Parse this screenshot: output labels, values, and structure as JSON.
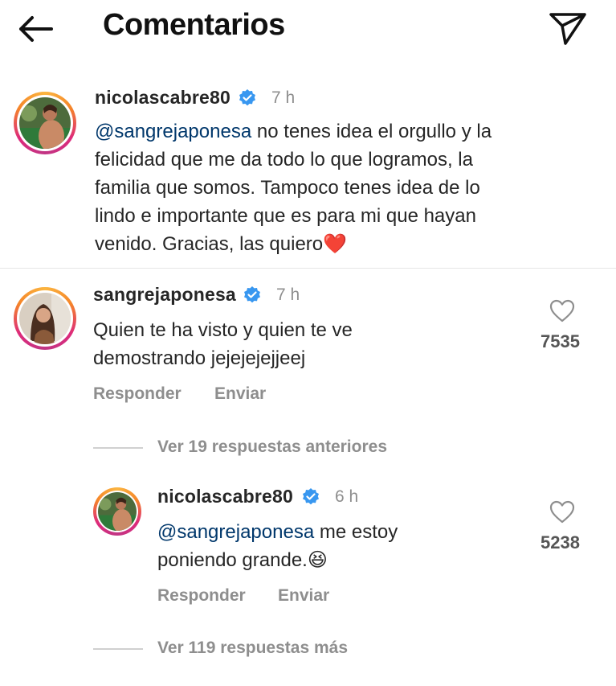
{
  "header": {
    "title": "Comentarios",
    "back_icon": "arrow-left-icon",
    "share_icon": "paper-plane-icon"
  },
  "caption": {
    "username": "nicolascabre80",
    "time": "7 h",
    "mention": "@sangrejaponesa",
    "lines": [
      " no tenes idea el orgullo y la",
      "felicidad que me da todo lo que logramos, la",
      "familia que somos.  Tampoco tenes idea de lo",
      "lindo e importante que es para mi que hayan",
      "venido. Gracias, las quiero"
    ],
    "emoji": "❤️"
  },
  "comment": {
    "username": "sangrejaponesa",
    "time": "7 h",
    "lines": [
      "Quien te ha visto y quien te ve",
      "demostrando jejejejejjeej"
    ],
    "likes": "7535",
    "reply_label": "Responder",
    "send_label": "Enviar"
  },
  "view_previous": "Ver 19 respuestas anteriores",
  "reply": {
    "username": "nicolascabre80",
    "time": "6 h",
    "mention": "@sangrejaponesa",
    "line1": " me estoy",
    "line2": "poniendo grande.",
    "emoji": "😆",
    "likes": "5238",
    "reply_label": "Responder",
    "send_label": "Enviar"
  },
  "view_more": "Ver 119 respuestas más",
  "colors": {
    "mention": "#00376b",
    "verified": "#3897f0",
    "heart_emoji": "#e0202c",
    "muted": "#8e8e8e"
  }
}
